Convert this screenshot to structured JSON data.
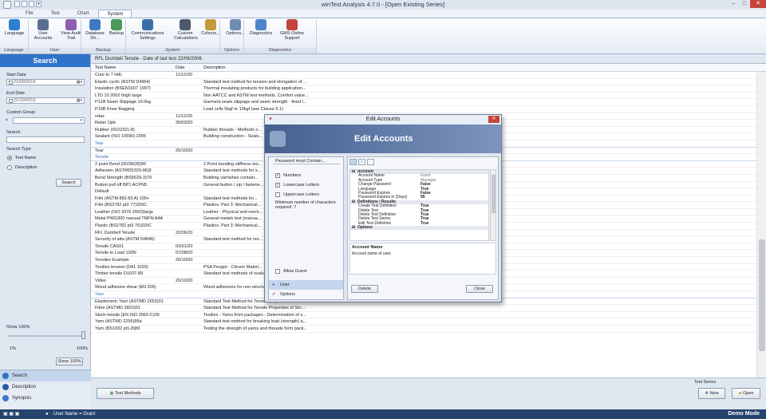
{
  "app": {
    "title": "winTest Analysis 4.7.0 - [Open Existing Series]"
  },
  "menu": {
    "tabs": [
      "File",
      "Test",
      "Chart",
      "System"
    ],
    "active": "System"
  },
  "ribbon": {
    "buttons": [
      {
        "label": "Language",
        "icon": "globe-icon",
        "color": "#2f7fd0"
      },
      {
        "label": "User Accounts",
        "icon": "users-icon",
        "color": "#5a6f8f"
      },
      {
        "label": "View Audit Trail",
        "icon": "audit-icon",
        "color": "#8c5fb0"
      },
      {
        "label": "Database Dir...",
        "icon": "database-icon",
        "color": "#3e7ac2"
      },
      {
        "label": "Backup",
        "icon": "backup-icon",
        "color": "#4a9a5e"
      },
      {
        "label": "Communications Settings",
        "icon": "network-icon",
        "color": "#3b6fa8"
      },
      {
        "label": "Custom Calculations",
        "icon": "calculator-icon",
        "color": "#4d5a6c"
      },
      {
        "label": "Colours...",
        "icon": "brush-icon",
        "color": "#c49a3a"
      },
      {
        "label": "Options...",
        "icon": "options-icon",
        "color": "#6f8bb0"
      },
      {
        "label": "Diagnostics",
        "icon": "diagnostics-icon",
        "color": "#4b86c8"
      },
      {
        "label": "GMS Online Support",
        "icon": "support-icon",
        "color": "#c2443d"
      }
    ],
    "groups": [
      "Language",
      "User",
      "Backup",
      "System",
      "Options",
      "Diagnostics"
    ]
  },
  "left": {
    "title": "Search",
    "start_date_label": "Start Date",
    "start_date": "21/09/2015",
    "end_date_label": "End Date",
    "end_date": "21/10/2015",
    "custom_group_label": "Custom Group",
    "search_label": "Search",
    "search_type_label": "Search Type",
    "opt_test_name": "Test Name",
    "opt_description": "Description",
    "search_button": "Search",
    "show_label": "Show",
    "show_value": "100%",
    "slider_min": "1%",
    "slider_max": "100%",
    "slider_value": 1.0,
    "show_button": "Show 100%",
    "nav": [
      "Search",
      "Description",
      "Synopsis"
    ]
  },
  "grid": {
    "caption": "RFL Dumbell Tensile - Date of last test 22/06/2006",
    "headers": [
      "Test Name",
      "Date",
      "Description"
    ],
    "rows": [
      {
        "type": "item",
        "name": "Cure to 7 Hdc",
        "date": "11/12/20",
        "desc": ""
      },
      {
        "type": "item",
        "name": "Elastic cyclic (ASTM D4964)",
        "date": "",
        "desc": "Standard test method for tension and elongation of ..."
      },
      {
        "type": "item",
        "name": "Insulation (BSEN1607 1997)",
        "date": "",
        "desc": "Thermal insulating products for building application..."
      },
      {
        "type": "item",
        "name": "LTD 10 2002 thigh large",
        "date": "",
        "desc": "Non AATCC and ASTM test methods. Comfort value..."
      },
      {
        "type": "item",
        "name": "P12A Seam Slippage 10.0kg",
        "date": "",
        "desc": "Garment seam slippage and seam strength - fixed l..."
      },
      {
        "type": "item",
        "name": "P15B Knee Bagging",
        "date": "",
        "desc": "Load cells 5kgf or 10kgf (see Clause 5.1)"
      },
      {
        "type": "item",
        "name": "relax",
        "date": "11/12/20",
        "desc": ""
      },
      {
        "type": "item",
        "name": "Relax Opti",
        "date": "30/03/20",
        "desc": ""
      },
      {
        "type": "item",
        "name": "Rubber (ISO2321-8)",
        "date": "",
        "desc": "Rubber threads - Methods o..."
      },
      {
        "type": "item",
        "name": "Sealant (ISO 10590) 2005",
        "date": "",
        "desc": "Building construction - Seals..."
      },
      {
        "type": "group",
        "name": "Tear",
        "date": "",
        "desc": ""
      },
      {
        "type": "item",
        "name": "Tear",
        "date": "20/10/20",
        "desc": ""
      },
      {
        "type": "group",
        "name": "Tensile",
        "date": "",
        "desc": ""
      },
      {
        "type": "item",
        "name": "2 point Bend (ISO5628)90",
        "date": "",
        "desc": "2 Point bending stiffness tes..."
      },
      {
        "type": "item",
        "name": "Adhesion (ASTMD5329-96)9",
        "date": "",
        "desc": "Standard test methods for s..."
      },
      {
        "type": "item",
        "name": "Bond Strength (BS5629-3)79",
        "date": "",
        "desc": "Building varnishes contain..."
      },
      {
        "type": "item",
        "name": "Button pull off BP1 ACPN5",
        "date": "",
        "desc": "General button / zip / fastene..."
      },
      {
        "type": "item",
        "name": "Default",
        "date": "",
        "desc": ""
      },
      {
        "type": "item",
        "name": "Film (ASTM 882-83 A) 100+",
        "date": "",
        "desc": "Standard test methods for..."
      },
      {
        "type": "item",
        "name": "Film (BS2782 pt3 77)326C",
        "date": "",
        "desc": "Plastics. Part 3: Mechanical..."
      },
      {
        "type": "item",
        "name": "Leather (ISO 3376 2002)large",
        "date": "",
        "desc": "Leather - Physical and mech..."
      },
      {
        "type": "item",
        "name": "Metal PWG300 manual TMFN A4A",
        "date": "",
        "desc": "General metals test (manua..."
      },
      {
        "type": "item",
        "name": "Plastic (BS2782 pt3 76)320C",
        "date": "",
        "desc": "Plastics. Part 3: Mechanical..."
      },
      {
        "type": "item",
        "name": "RFL Dumbell Tensile",
        "date": "22/06/20",
        "desc": ""
      },
      {
        "type": "item",
        "name": "Security of atta (ASTM D4846)",
        "date": "",
        "desc": "Standard test method for res..."
      },
      {
        "type": "item",
        "name": "Tensile CAS01",
        "date": "03/01/20",
        "desc": ""
      },
      {
        "type": "item",
        "name": "Tensile to Load 100N",
        "date": "07/08/20",
        "desc": ""
      },
      {
        "type": "item",
        "name": "Tensiles Example",
        "date": "20/10/20",
        "desc": ""
      },
      {
        "type": "item",
        "name": "Textiles tension (D41 1029)",
        "date": "",
        "desc": "PSA Peugot - Citroen Materi..."
      },
      {
        "type": "item",
        "name": "Timber tensile D1037-89",
        "date": "",
        "desc": "Standard test methods of evaluating the properties ..."
      },
      {
        "type": "item",
        "name": "Video",
        "date": "20/10/20",
        "desc": ""
      },
      {
        "type": "item",
        "name": "Wood adhesive shear (EN 205)",
        "date": "",
        "desc": "Wood adhesives for non-structural applications - D..."
      },
      {
        "type": "group",
        "name": "Yarn",
        "date": "",
        "desc": ""
      },
      {
        "type": "item",
        "name": "Elastomeric Yarn (ASTMD 2653)01",
        "date": "",
        "desc": "Standard Test Method for Tensile Properties of Ela..."
      },
      {
        "type": "item",
        "name": "Fibre (ASTMD 3822)01",
        "date": "",
        "desc": "Standard Test Method for Tensile Properties of Sin..."
      },
      {
        "type": "item",
        "name": "Skein tensile (EN ISO 2062-C)09",
        "date": "",
        "desc": "Textiles - Yarns from packages - Determination of s..."
      },
      {
        "type": "item",
        "name": "Yarn (ASTMD 2256)95a",
        "date": "",
        "desc": "Standard test method for breaking load (strength) a..."
      },
      {
        "type": "item",
        "name": "Yarn (BS1932 pt1-8)89",
        "date": "",
        "desc": "Testing the strength of yarns and threads form pack..."
      }
    ]
  },
  "footer": {
    "test_methods_button": "Test Methods",
    "test_series_label": "Test Series",
    "new_button": "New",
    "open_button": "Open"
  },
  "status": {
    "user": "User Name = Grant",
    "mode": "Demo Mode"
  },
  "dialog": {
    "title": "Edit Accounts",
    "header": "Edit Accounts",
    "password_group": "Password must Contain...",
    "numbers": "Numbers",
    "lowercase": "Lowercase Letters",
    "uppercase": "Uppercase Letters",
    "min_chars_label": "Minimum number of characters required: 7",
    "allow_guest": "Allow Guest",
    "nav": [
      "User",
      "Options"
    ],
    "property_rows": [
      {
        "type": "cat",
        "name": "Account",
        "value": ""
      },
      {
        "type": "prop",
        "name": "Account Name",
        "value": "Grant",
        "bold": false
      },
      {
        "type": "prop",
        "name": "Account Type",
        "value": "Manager",
        "bold": false
      },
      {
        "type": "prop",
        "name": "Change Password",
        "value": "False",
        "bold": true
      },
      {
        "type": "prop",
        "name": "Language",
        "value": "True",
        "bold": true
      },
      {
        "type": "prop",
        "name": "Password Expires",
        "value": "False",
        "bold": true
      },
      {
        "type": "prop",
        "name": "Password Expires in (Days)",
        "value": "90",
        "bold": true
      },
      {
        "type": "cat",
        "name": "Definitions / Results",
        "value": ""
      },
      {
        "type": "prop",
        "name": "Create Test Definition",
        "value": "True",
        "bold": true
      },
      {
        "type": "prop",
        "name": "Delete Test",
        "value": "True",
        "bold": true
      },
      {
        "type": "prop",
        "name": "Delete Test Definition",
        "value": "True",
        "bold": true
      },
      {
        "type": "prop",
        "name": "Delete Test Series",
        "value": "True",
        "bold": true
      },
      {
        "type": "prop",
        "name": "Edit Test Definition",
        "value": "True",
        "bold": true
      },
      {
        "type": "cat",
        "name": "Options",
        "value": ""
      }
    ],
    "help_title": "Account Name",
    "help_text": "Account name of user.",
    "delete_button": "Delete",
    "close_button": "Close"
  }
}
